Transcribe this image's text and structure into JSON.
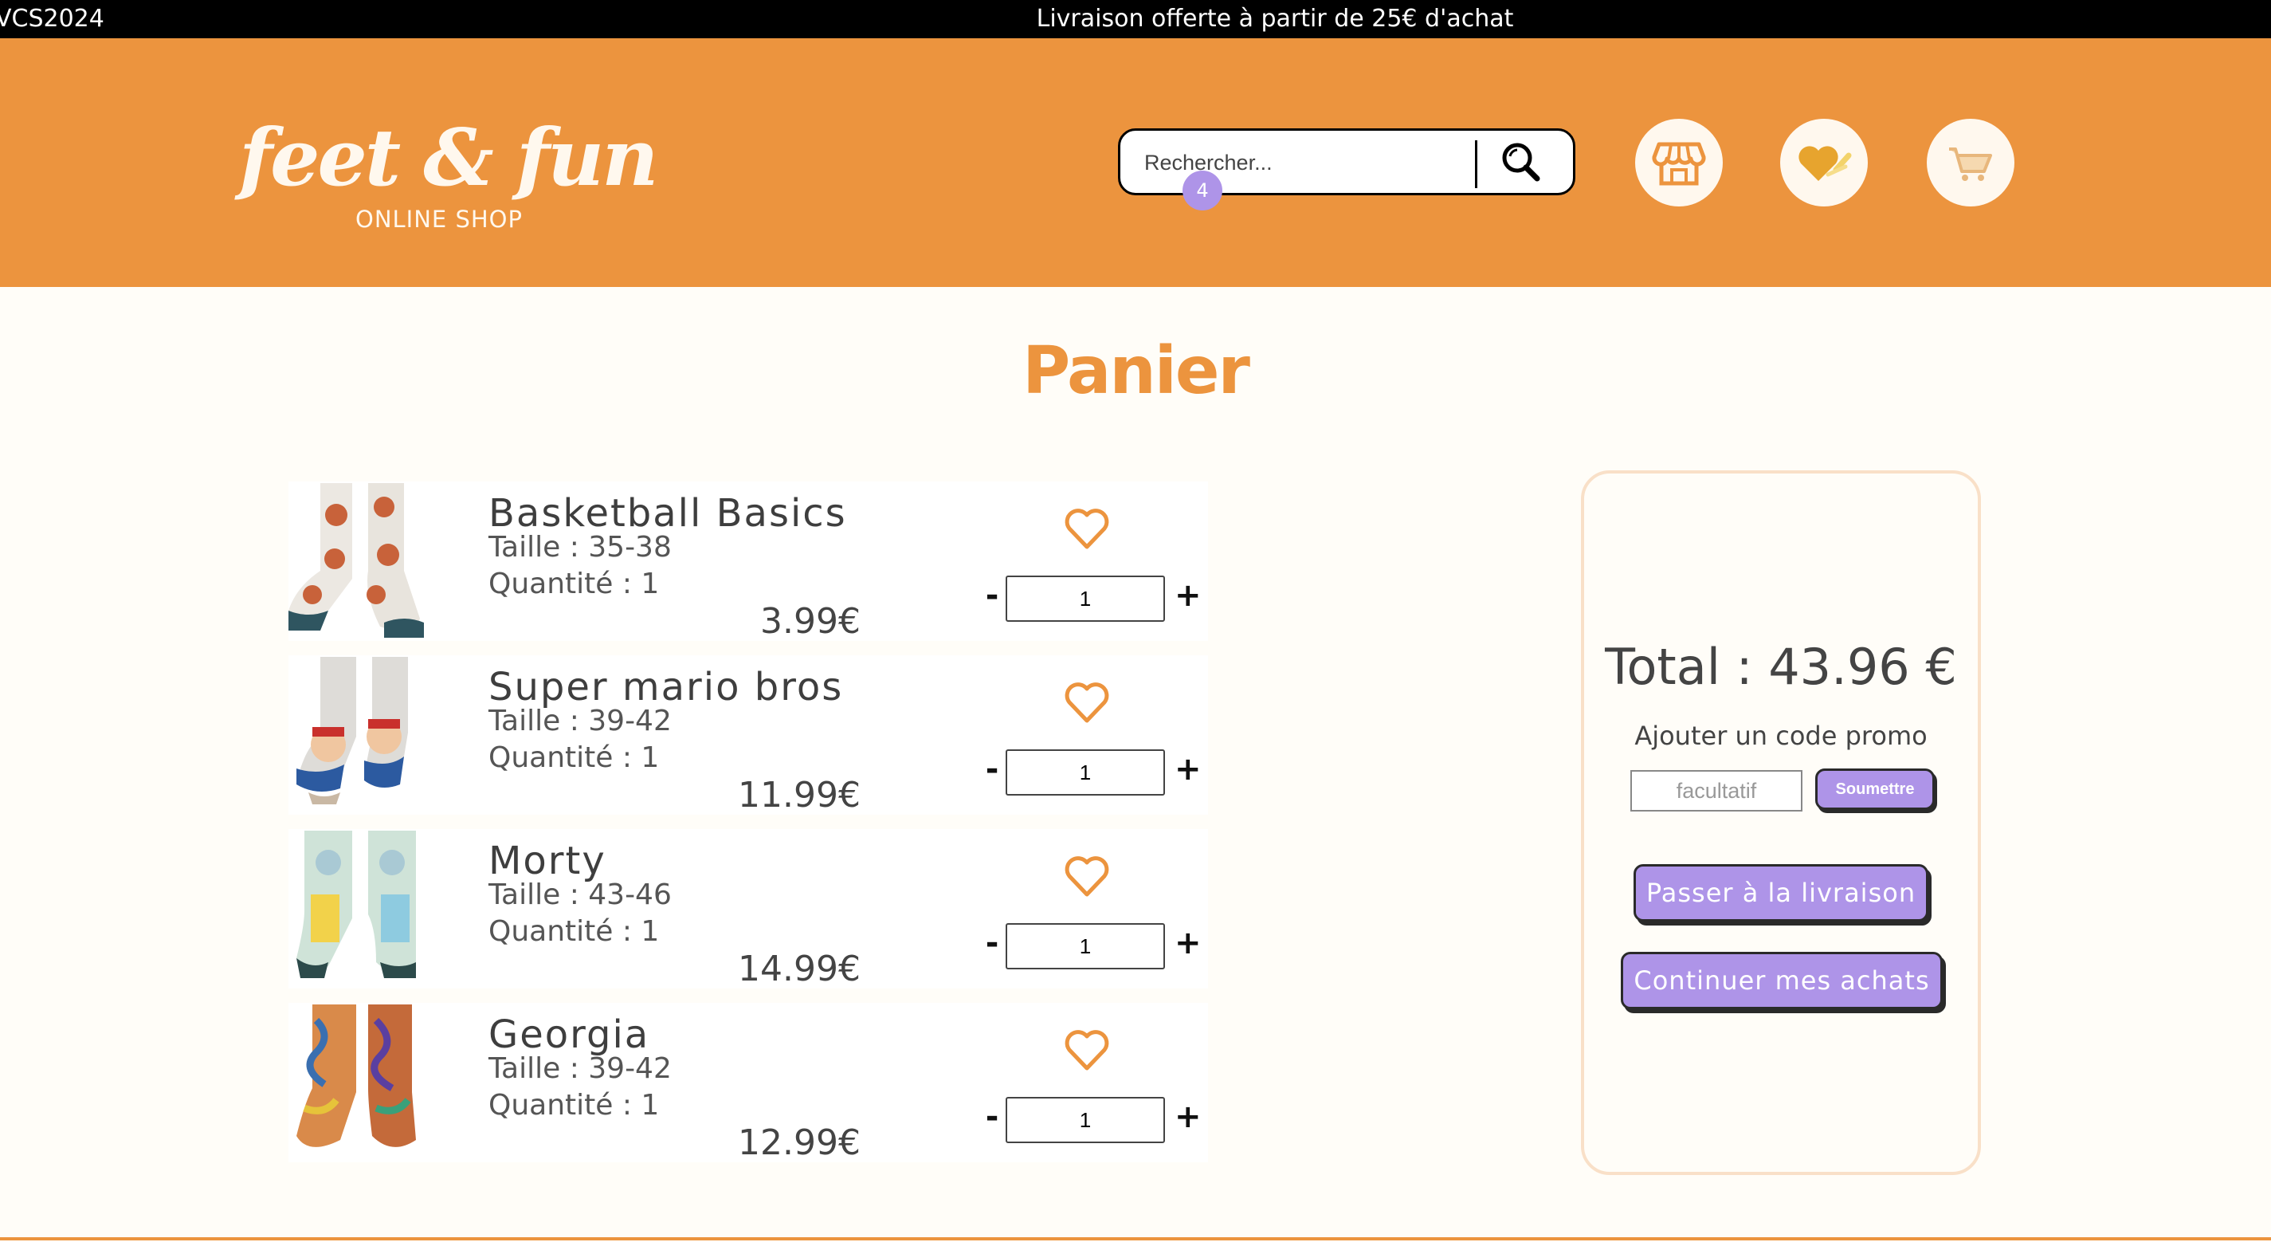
{
  "banner": {
    "code_text": "VCS2024",
    "message": "Livraison offerte à partir de 25€ d'achat"
  },
  "header": {
    "logo_text": "feet & fun",
    "logo_subtitle": "ONLINE SHOP",
    "search_placeholder": "Rechercher...",
    "icons": [
      "search-icon",
      "shop-icon",
      "heart-icon",
      "cart-icon"
    ],
    "cart_count": "4"
  },
  "page": {
    "title": "Panier"
  },
  "cart": {
    "items": [
      {
        "name": "Basketball Basics",
        "size": "Taille : 35-38",
        "quantity": "Quantité : 1",
        "price": "3.99€",
        "qty_value": "1"
      },
      {
        "name": "Super mario bros",
        "size": "Taille : 39-42",
        "quantity": "Quantité : 1",
        "price": "11.99€",
        "qty_value": "1"
      },
      {
        "name": "Morty",
        "size": "Taille : 43-46",
        "quantity": "Quantité : 1",
        "price": "14.99€",
        "qty_value": "1"
      },
      {
        "name": "Georgia",
        "size": "Taille : 39-42",
        "quantity": "Quantité : 1",
        "price": "12.99€",
        "qty_value": "1"
      }
    ],
    "minus_label": "-",
    "plus_label": "+"
  },
  "summary": {
    "total": "Total : 43.96 €",
    "promo_label": "Ajouter un code promo",
    "promo_placeholder": "facultatif",
    "promo_submit": "Soumettre",
    "shipping_button": "Passer à la livraison",
    "continue_button": "Continuer mes achats"
  },
  "colors": {
    "accent": "#ec943e",
    "button": "#ae94e8",
    "background": "#fffdf8",
    "banner": "#000000"
  }
}
